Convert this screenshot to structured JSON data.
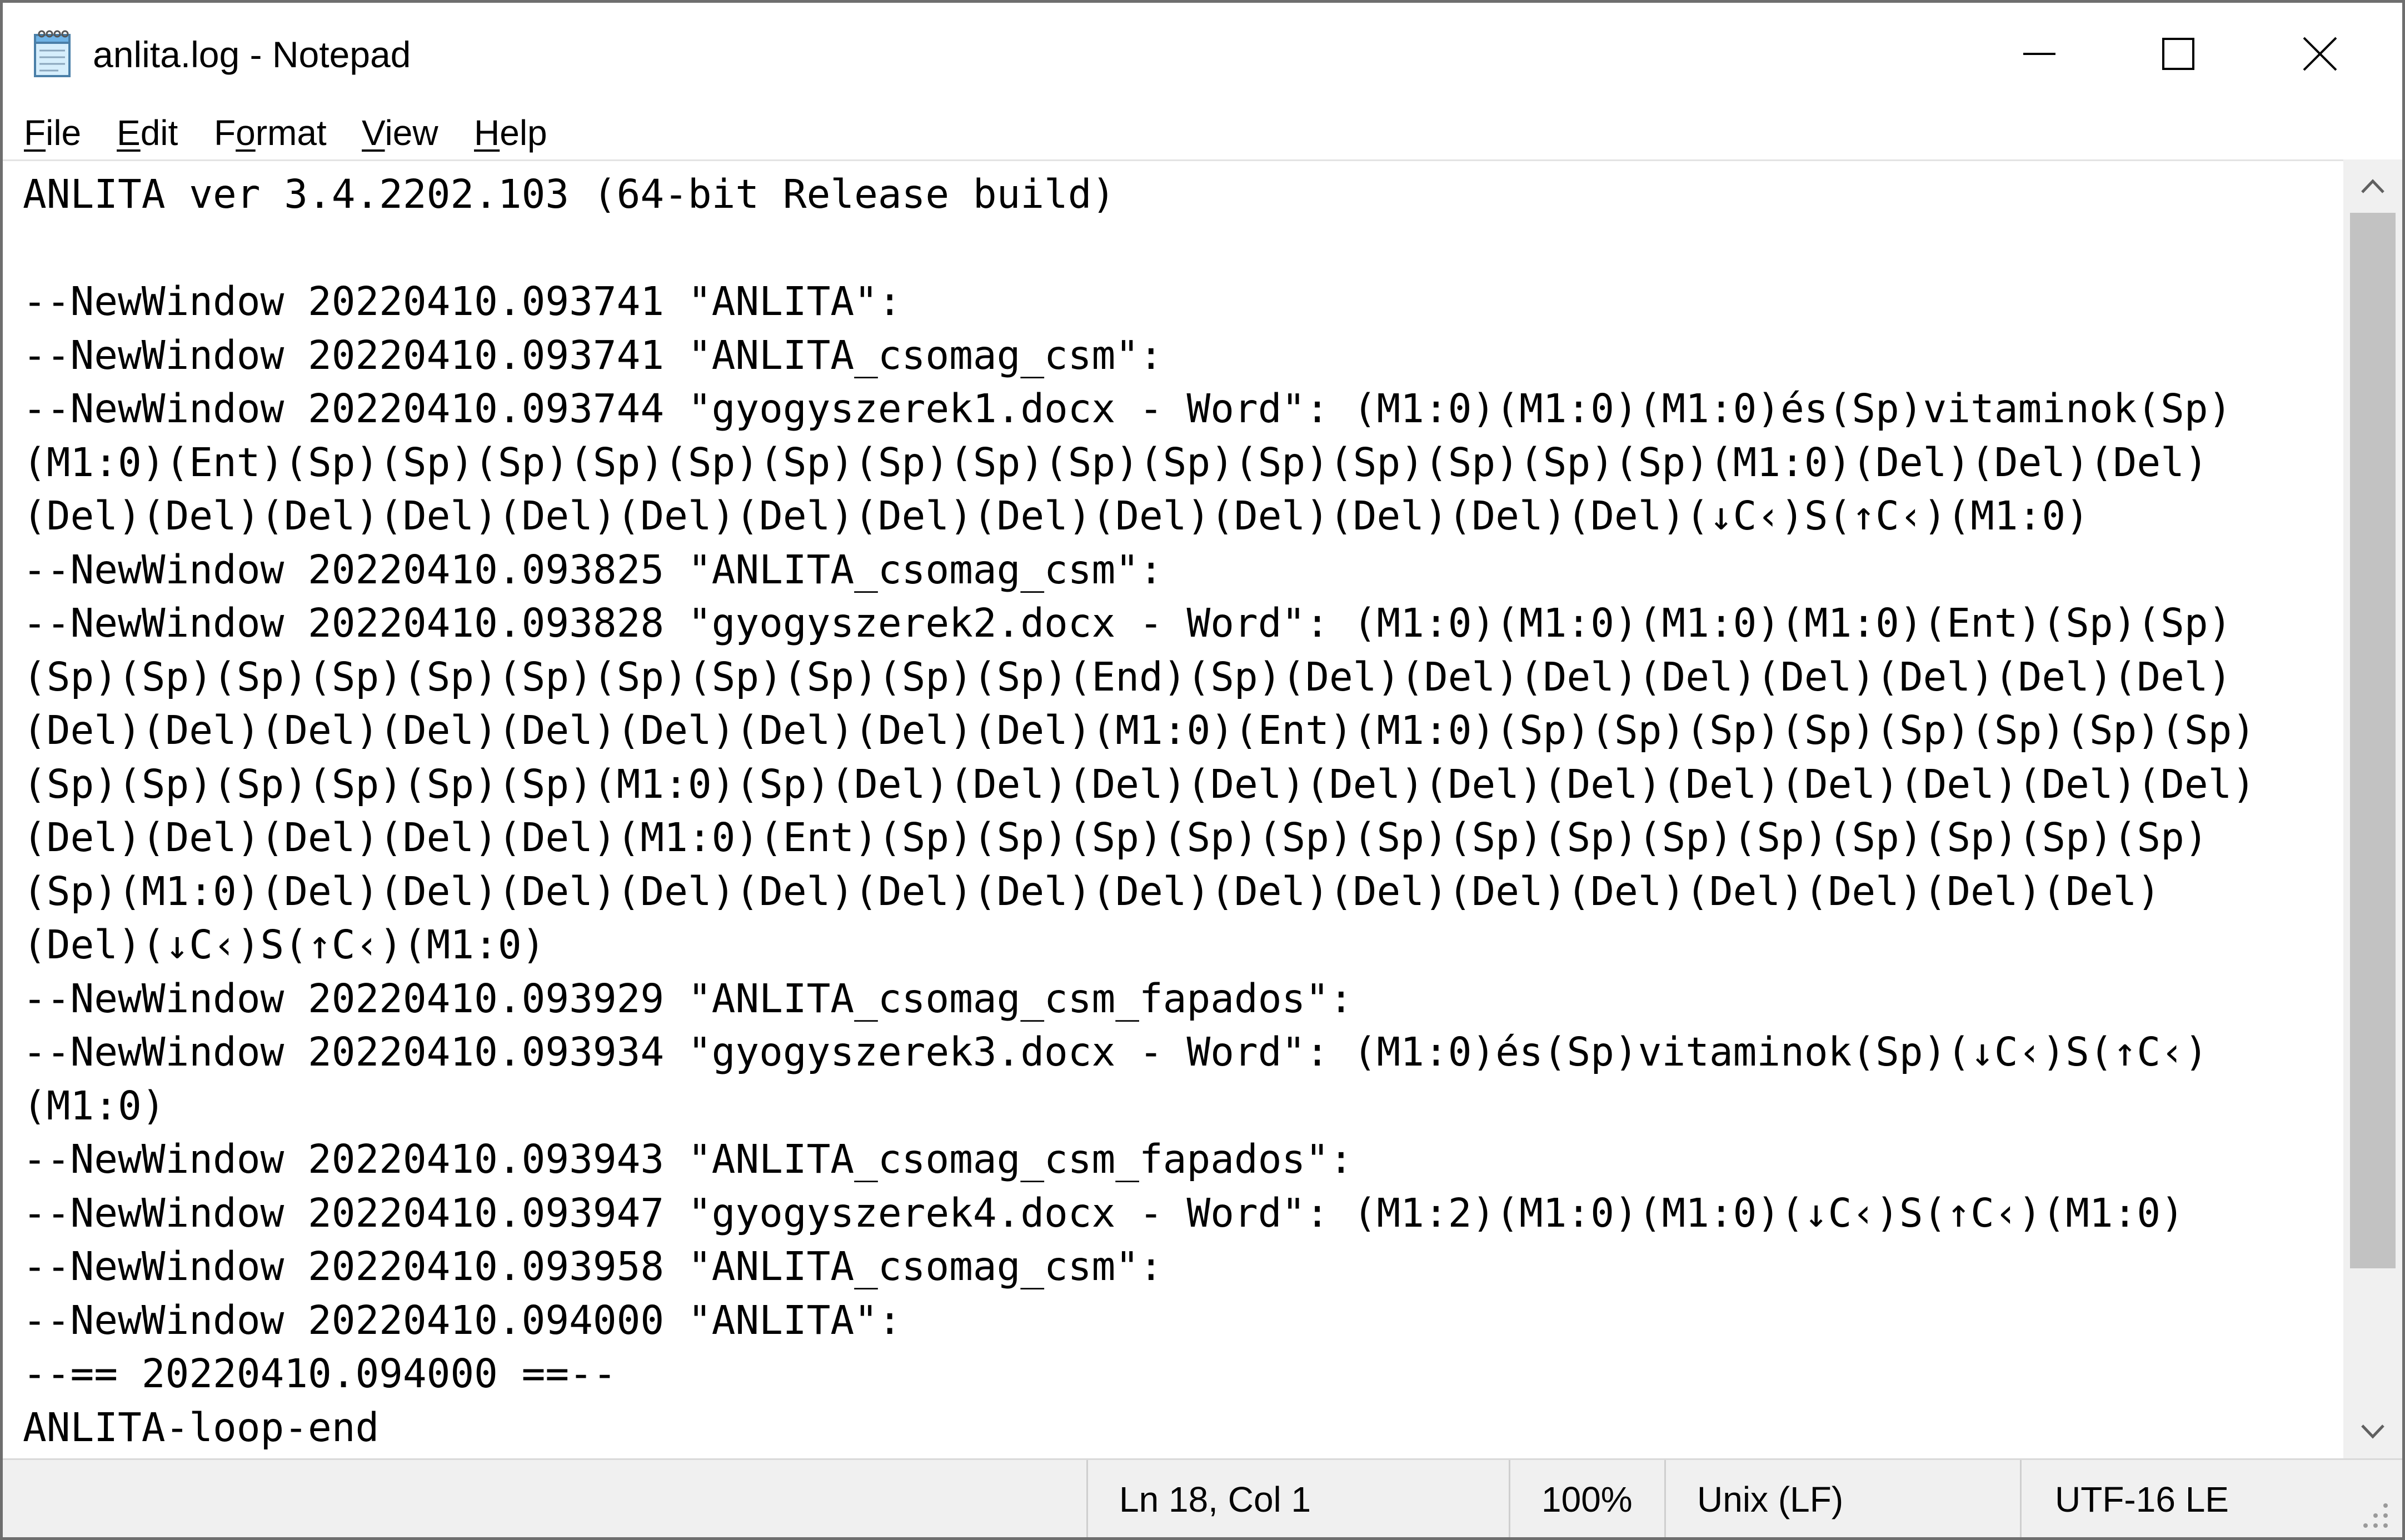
{
  "window": {
    "title": "anlita.log - Notepad",
    "app_icon": "notepad-icon",
    "controls": [
      "minimize-icon",
      "maximize-icon",
      "close-icon"
    ]
  },
  "menu": {
    "file": {
      "accel": "F",
      "rest": "ile"
    },
    "edit": {
      "accel": "E",
      "rest": "dit"
    },
    "format": {
      "pre": "F",
      "accel": "o",
      "rest": "rmat"
    },
    "view": {
      "accel": "V",
      "rest": "iew"
    },
    "help": {
      "accel": "H",
      "rest": "elp"
    }
  },
  "editor": {
    "lines": [
      "ANLITA ver 3.4.2202.103 (64-bit Release build)",
      "",
      "--NewWindow 20220410.093741 \"ANLITA\":",
      "--NewWindow 20220410.093741 \"ANLITA_csomag_csm\":",
      "--NewWindow 20220410.093744 \"gyogyszerek1.docx - Word\": (M1:0)(M1:0)(M1:0)és(Sp)vitaminok(Sp)",
      "(M1:0)(Ent)(Sp)(Sp)(Sp)(Sp)(Sp)(Sp)(Sp)(Sp)(Sp)(Sp)(Sp)(Sp)(Sp)(Sp)(Sp)(M1:0)(Del)(Del)(Del)",
      "(Del)(Del)(Del)(Del)(Del)(Del)(Del)(Del)(Del)(Del)(Del)(Del)(Del)(Del)(↓C‹)S(↑C‹)(M1:0)",
      "--NewWindow 20220410.093825 \"ANLITA_csomag_csm\":",
      "--NewWindow 20220410.093828 \"gyogyszerek2.docx - Word\": (M1:0)(M1:0)(M1:0)(M1:0)(Ent)(Sp)(Sp)",
      "(Sp)(Sp)(Sp)(Sp)(Sp)(Sp)(Sp)(Sp)(Sp)(Sp)(Sp)(End)(Sp)(Del)(Del)(Del)(Del)(Del)(Del)(Del)(Del)",
      "(Del)(Del)(Del)(Del)(Del)(Del)(Del)(Del)(Del)(M1:0)(Ent)(M1:0)(Sp)(Sp)(Sp)(Sp)(Sp)(Sp)(Sp)(Sp)",
      "(Sp)(Sp)(Sp)(Sp)(Sp)(Sp)(M1:0)(Sp)(Del)(Del)(Del)(Del)(Del)(Del)(Del)(Del)(Del)(Del)(Del)(Del)",
      "(Del)(Del)(Del)(Del)(Del)(M1:0)(Ent)(Sp)(Sp)(Sp)(Sp)(Sp)(Sp)(Sp)(Sp)(Sp)(Sp)(Sp)(Sp)(Sp)(Sp)",
      "(Sp)(M1:0)(Del)(Del)(Del)(Del)(Del)(Del)(Del)(Del)(Del)(Del)(Del)(Del)(Del)(Del)(Del)(Del)",
      "(Del)(↓C‹)S(↑C‹)(M1:0)",
      "--NewWindow 20220410.093929 \"ANLITA_csomag_csm_fapados\":",
      "--NewWindow 20220410.093934 \"gyogyszerek3.docx - Word\": (M1:0)és(Sp)vitaminok(Sp)(↓C‹)S(↑C‹)",
      "(M1:0)",
      "--NewWindow 20220410.093943 \"ANLITA_csomag_csm_fapados\":",
      "--NewWindow 20220410.093947 \"gyogyszerek4.docx - Word\": (M1:2)(M1:0)(M1:0)(↓C‹)S(↑C‹)(M1:0)",
      "--NewWindow 20220410.093958 \"ANLITA_csomag_csm\":",
      "--NewWindow 20220410.094000 \"ANLITA\":",
      "--== 20220410.094000 ==--",
      "ANLITA-loop-end"
    ]
  },
  "scrollbar": {
    "up_icon": "chevron-up-icon",
    "down_icon": "chevron-down-icon"
  },
  "status": {
    "position": "Ln 18, Col 1",
    "zoom": "100%",
    "line_ending": "Unix (LF)",
    "encoding": "UTF-16 LE"
  },
  "colors": {
    "window_border": "#6e6e6e",
    "scrollbar_track": "#f0f0f0",
    "scrollbar_thumb": "#c2c2c2",
    "statusbar_bg": "#f0f0f0"
  }
}
